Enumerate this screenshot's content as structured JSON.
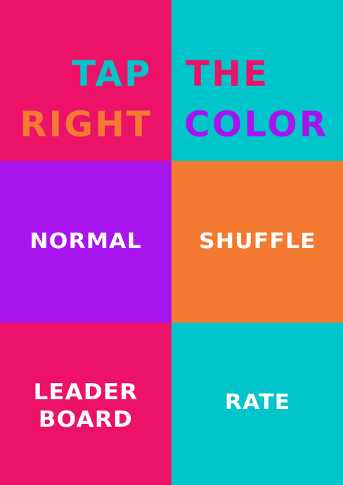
{
  "colors": {
    "pink": "#EC1267",
    "cyan": "#00C5CB",
    "purple": "#A814EE",
    "orange": "#F47A31",
    "white": "#FFFFFF"
  },
  "title": {
    "tap": "TAP",
    "the": "THE",
    "right": "RIGHT",
    "color": "COLOR"
  },
  "menu": {
    "normal": "NORMAL",
    "shuffle": "SHUFFLE",
    "leaderboard_line1": "LEADER",
    "leaderboard_line2": "BOARD",
    "rate": "RATE"
  }
}
